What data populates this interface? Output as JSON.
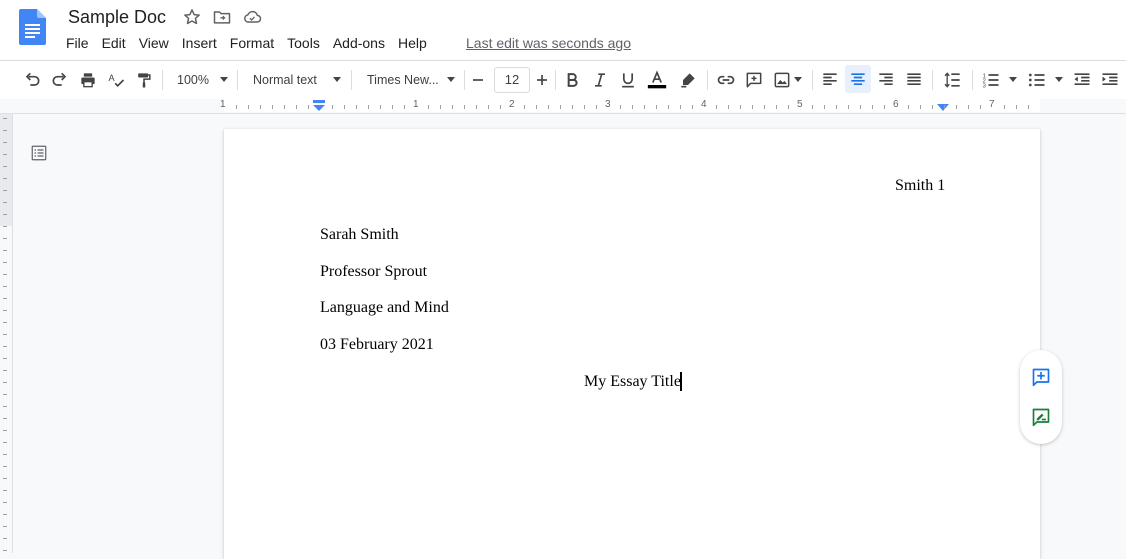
{
  "app": {
    "doc_title": "Sample Doc",
    "brand_color": "#4285f4"
  },
  "menu": {
    "items": [
      "File",
      "Edit",
      "View",
      "Insert",
      "Format",
      "Tools",
      "Add-ons",
      "Help"
    ],
    "last_edit": "Last edit was seconds ago"
  },
  "toolbar": {
    "zoom": "100%",
    "style": "Normal text",
    "font": "Times New...",
    "font_size": "12",
    "text_color": "#000000",
    "active_alignment": "center",
    "icons": [
      "undo-icon",
      "redo-icon",
      "print-icon",
      "spellcheck-icon",
      "paint-format-icon",
      "bold-icon",
      "italic-icon",
      "underline-icon",
      "text-color-icon",
      "highlight-icon",
      "link-icon",
      "comment-icon",
      "image-icon",
      "align-left-icon",
      "align-center-icon",
      "align-right-icon",
      "justify-icon",
      "line-spacing-icon",
      "numbered-list-icon",
      "bulleted-list-icon",
      "decrease-indent-icon",
      "increase-indent-icon"
    ]
  },
  "ruler": {
    "labels": [
      "1",
      "1",
      "2",
      "3",
      "4",
      "5",
      "6",
      "7"
    ]
  },
  "document": {
    "header_text": "Smith 1",
    "lines": [
      "Sarah Smith",
      "Professor Sprout",
      "Language and Mind",
      "03 February 2021"
    ],
    "title": "My Essay Title"
  },
  "side_buttons": {
    "accent_add": "#1a73e8",
    "accent_suggest": "#188038"
  }
}
